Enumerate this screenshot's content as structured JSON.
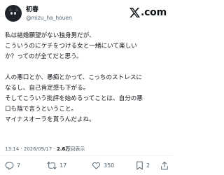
{
  "author": {
    "display_name": "初春",
    "handle": "@mizu_ha_houen",
    "avatar_icon": "cat-avatar"
  },
  "source": {
    "logo_text": ".com",
    "logo_icon": "x-logo-icon"
  },
  "tweet": {
    "lines": [
      "私は結婚願望がない独身男だが、",
      "こういうのにケチをつける女と一緒にいて楽しい",
      "か？ってのが全てだと思う。",
      "",
      "人の悪口とか、愚痴とかって、こっちのストレスに",
      "なるし、自己肯定感も下がる。",
      "そしてこういう批評を始めるってことは、自分の悪",
      "口も陰で言うということ。",
      "マイナスオーラを貰うんだよね。"
    ]
  },
  "meta": {
    "time": "13:14",
    "separator": "·",
    "date": "2026/09/17",
    "views_count": "2.6万",
    "views_label": "回表示"
  },
  "actions": {
    "reply_count": "7",
    "retweet_count": "17",
    "like_count": "350",
    "bookmark_count": "2"
  },
  "colors": {
    "text": "#0f1419",
    "secondary": "#536471",
    "divider": "#eff3f4",
    "background": "#ffffff"
  }
}
